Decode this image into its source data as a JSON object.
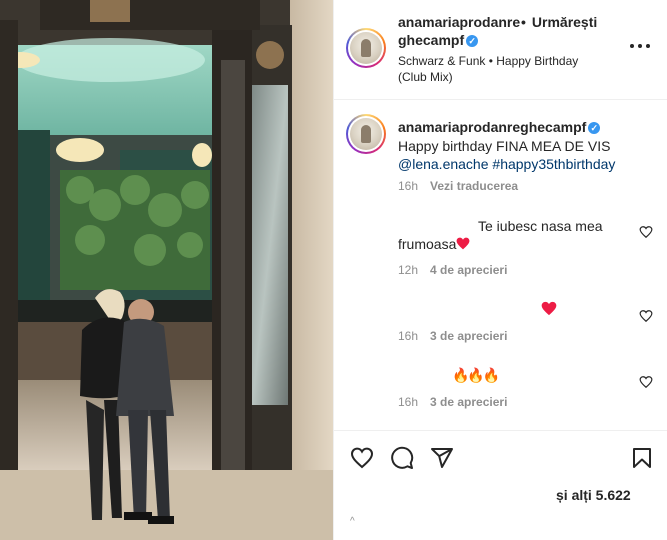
{
  "post": {
    "header": {
      "username_line1": "anamariaprodanre",
      "username_line2": "ghecampf",
      "follow_dot": "•",
      "follow_label": "Urmărești",
      "audio": "Schwarz & Funk • Happy Birthday (Club Mix)",
      "more_icon": "more-horizontal-icon"
    },
    "caption": {
      "username": "anamariaprodanreghecampf",
      "text": "Happy birthday FINA MEA DE VIS",
      "mention": "@lena.enache",
      "hashtag": "#happy35thbirthday",
      "time": "16h",
      "translate_label": "Vezi traducerea"
    },
    "comments": [
      {
        "text_line1": "Te iubesc nasa mea",
        "text_line2": "frumoasa",
        "emoji": "red-heart",
        "time": "12h",
        "likes": "4 de aprecieri"
      },
      {
        "text": "",
        "emoji": "red-heart",
        "time": "16h",
        "likes": "3 de aprecieri"
      },
      {
        "text": "🔥🔥🔥",
        "time": "16h",
        "likes": "3 de aprecieri"
      }
    ],
    "actions": {
      "like_icon": "heart-outline-icon",
      "comment_icon": "comment-bubble-icon",
      "share_icon": "paper-plane-icon",
      "save_icon": "bookmark-icon",
      "likes_text": "și alți 5.622",
      "tiny_mark": "^"
    }
  },
  "colors": {
    "text": "#262626",
    "secondary": "#8e8e8e",
    "link": "#00376b",
    "verified": "#3897f0",
    "heart_red": "#ed1c45",
    "border": "#efefef"
  }
}
